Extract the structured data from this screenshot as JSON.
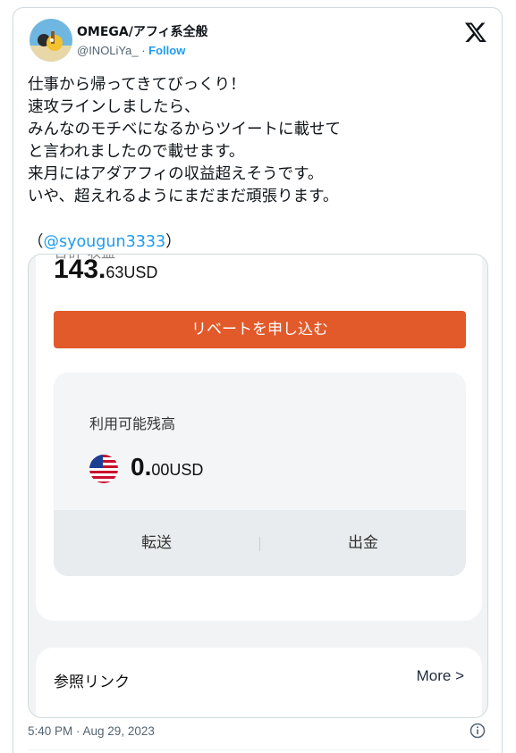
{
  "author": {
    "display_name": "OMEGA/アフィ系全般",
    "handle": "@INOLiYa_",
    "separator": " · ",
    "follow_label": "Follow"
  },
  "tweet": {
    "text": "仕事から帰ってきてびっくり！\n速攻ラインしましたら、\nみんなのモチベになるからツイートに載せて\nと言われましたので載せます。\n来月にはアダアフィの収益超えそうです。\nいや、超えれるようにまだまだ頑張ります。",
    "mention_open": "（",
    "mention": "@syougun3333",
    "mention_close": "）",
    "timestamp": "5:40 PM · Aug 29, 2023"
  },
  "media": {
    "cut_label": "合計 収益",
    "amount_int": "143.",
    "amount_dec": "63USD",
    "rebate_button": "リベートを申し込む",
    "balance_label": "利用可能残高",
    "balance_int": "0.",
    "balance_dec": "00USD",
    "transfer_label": "転送",
    "withdraw_label": "出金",
    "referral_label": "参照リンク",
    "more_label": "More >"
  },
  "colors": {
    "link": "#1d9bf0",
    "rebate_button": "#e2592a"
  },
  "icons": {
    "brand": "x-logo-icon",
    "flag": "us-flag-icon",
    "info": "info-icon"
  }
}
